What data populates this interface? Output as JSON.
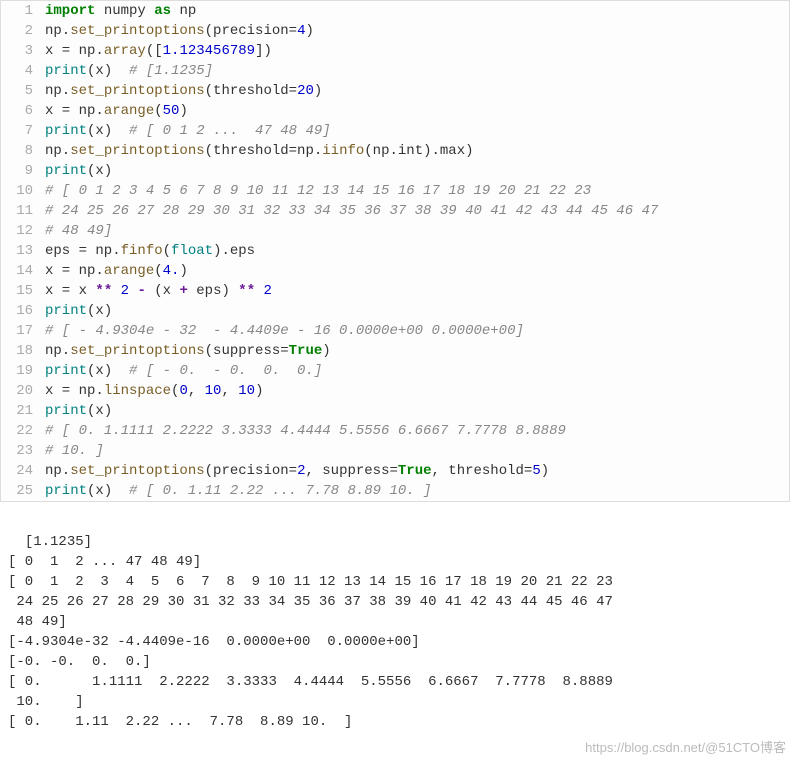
{
  "code_lines": [
    {
      "n": 1,
      "html": "<span class='kw'>import</span> numpy <span class='kw'>as</span> np"
    },
    {
      "n": 2,
      "html": "np.<span class='fn'>set_printoptions</span>(precision=<span class='num'>4</span>)"
    },
    {
      "n": 3,
      "html": "x = np.<span class='fn'>array</span>([<span class='num'>1.123456789</span>])"
    },
    {
      "n": 4,
      "html": "<span class='builtin'>print</span>(x)  <span class='comment'># [1.1235]</span>"
    },
    {
      "n": 5,
      "html": "np.<span class='fn'>set_printoptions</span>(threshold=<span class='num'>20</span>)"
    },
    {
      "n": 6,
      "html": "x = np.<span class='fn'>arange</span>(<span class='num'>50</span>)"
    },
    {
      "n": 7,
      "html": "<span class='builtin'>print</span>(x)  <span class='comment'># [ 0 1 2 ...  47 48 49]</span>"
    },
    {
      "n": 8,
      "html": "np.<span class='fn'>set_printoptions</span>(threshold=np.<span class='fn'>iinfo</span>(np.int).max)"
    },
    {
      "n": 9,
      "html": "<span class='builtin'>print</span>(x)"
    },
    {
      "n": 10,
      "html": "<span class='comment'># [ 0 1 2 3 4 5 6 7 8 9 10 11 12 13 14 15 16 17 18 19 20 21 22 23</span>"
    },
    {
      "n": 11,
      "html": "<span class='comment'># 24 25 26 27 28 29 30 31 32 33 34 35 36 37 38 39 40 41 42 43 44 45 46 47</span>"
    },
    {
      "n": 12,
      "html": "<span class='comment'># 48 49]</span>"
    },
    {
      "n": 13,
      "html": "eps = np.<span class='fn'>finfo</span>(<span class='builtin'>float</span>).eps"
    },
    {
      "n": 14,
      "html": "x = np.<span class='fn'>arange</span>(<span class='num'>4.</span>)"
    },
    {
      "n": 15,
      "html": "x = x <span class='op'>**</span> <span class='num'>2</span> <span class='op'>-</span> (x <span class='op'>+</span> eps) <span class='op'>**</span> <span class='num'>2</span>"
    },
    {
      "n": 16,
      "html": "<span class='builtin'>print</span>(x)"
    },
    {
      "n": 17,
      "html": "<span class='comment'># [ - 4.9304e - 32  - 4.4409e - 16 0.0000e+00 0.0000e+00]</span>"
    },
    {
      "n": 18,
      "html": "np.<span class='fn'>set_printoptions</span>(suppress=<span class='bool'>True</span>)"
    },
    {
      "n": 19,
      "html": "<span class='builtin'>print</span>(x)  <span class='comment'># [ - 0.  - 0.  0.  0.]</span>"
    },
    {
      "n": 20,
      "html": "x = np.<span class='fn'>linspace</span>(<span class='num'>0</span>, <span class='num'>10</span>, <span class='num'>10</span>)"
    },
    {
      "n": 21,
      "html": "<span class='builtin'>print</span>(x)"
    },
    {
      "n": 22,
      "html": "<span class='comment'># [ 0. 1.1111 2.2222 3.3333 4.4444 5.5556 6.6667 7.7778 8.8889</span>"
    },
    {
      "n": 23,
      "html": "<span class='comment'># 10. ]</span>"
    },
    {
      "n": 24,
      "html": "np.<span class='fn'>set_printoptions</span>(precision=<span class='num'>2</span>, suppress=<span class='bool'>True</span>, threshold=<span class='num'>5</span>)"
    },
    {
      "n": 25,
      "html": "<span class='builtin'>print</span>(x)  <span class='comment'># [ 0. 1.11 2.22 ... 7.78 8.89 10. ]</span>"
    }
  ],
  "output": "[1.1235]\n[ 0  1  2 ... 47 48 49]\n[ 0  1  2  3  4  5  6  7  8  9 10 11 12 13 14 15 16 17 18 19 20 21 22 23\n 24 25 26 27 28 29 30 31 32 33 34 35 36 37 38 39 40 41 42 43 44 45 46 47\n 48 49]\n[-4.9304e-32 -4.4409e-16  0.0000e+00  0.0000e+00]\n[-0. -0.  0.  0.]\n[ 0.      1.1111  2.2222  3.3333  4.4444  5.5556  6.6667  7.7778  8.8889\n 10.    ]\n[ 0.    1.11  2.22 ...  7.78  8.89 10.  ]",
  "watermark": "https://blog.csdn.net/@51CTO博客"
}
